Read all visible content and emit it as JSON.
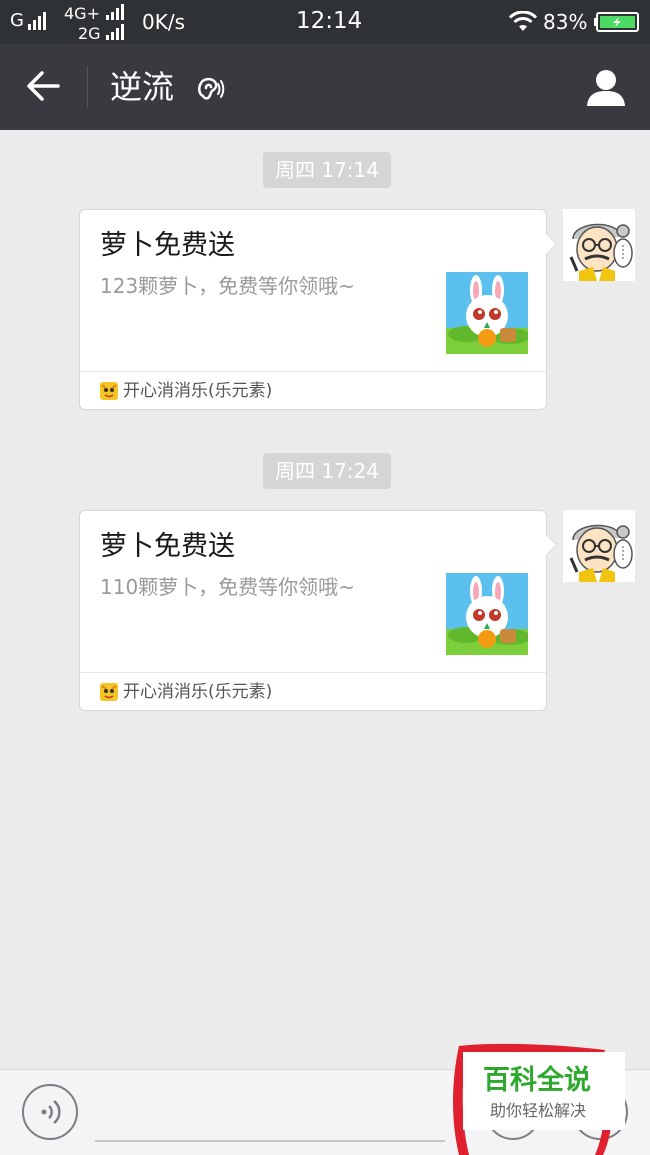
{
  "status_bar": {
    "carrier1": "G",
    "net_top": "4G+",
    "net_bottom": "2G",
    "speed": "0K/s",
    "time": "12:14",
    "battery": "83%"
  },
  "nav": {
    "title": "逆流",
    "back_icon": "arrow-left-icon",
    "ear_icon": "ear-icon",
    "profile_icon": "person-icon"
  },
  "messages": [
    {
      "time": "周四 17:14",
      "title": "萝卜免费送",
      "description": "123颗萝卜，免费等你领哦~",
      "app": "开心消消乐(乐元素)"
    },
    {
      "time": "周四 17:24",
      "title": "萝卜免费送",
      "description": "110颗萝卜，免费等你领哦~",
      "app": "开心消消乐(乐元素)"
    }
  ],
  "watermark": {
    "brand": "百科全说",
    "slogan": "助你轻松解决"
  },
  "colors": {
    "status_bg": "#2f3234",
    "nav_bg": "#393a3f",
    "chat_bg": "#ebebeb",
    "watermark_green": "#2ea92e",
    "battery_green": "#4cd964"
  }
}
